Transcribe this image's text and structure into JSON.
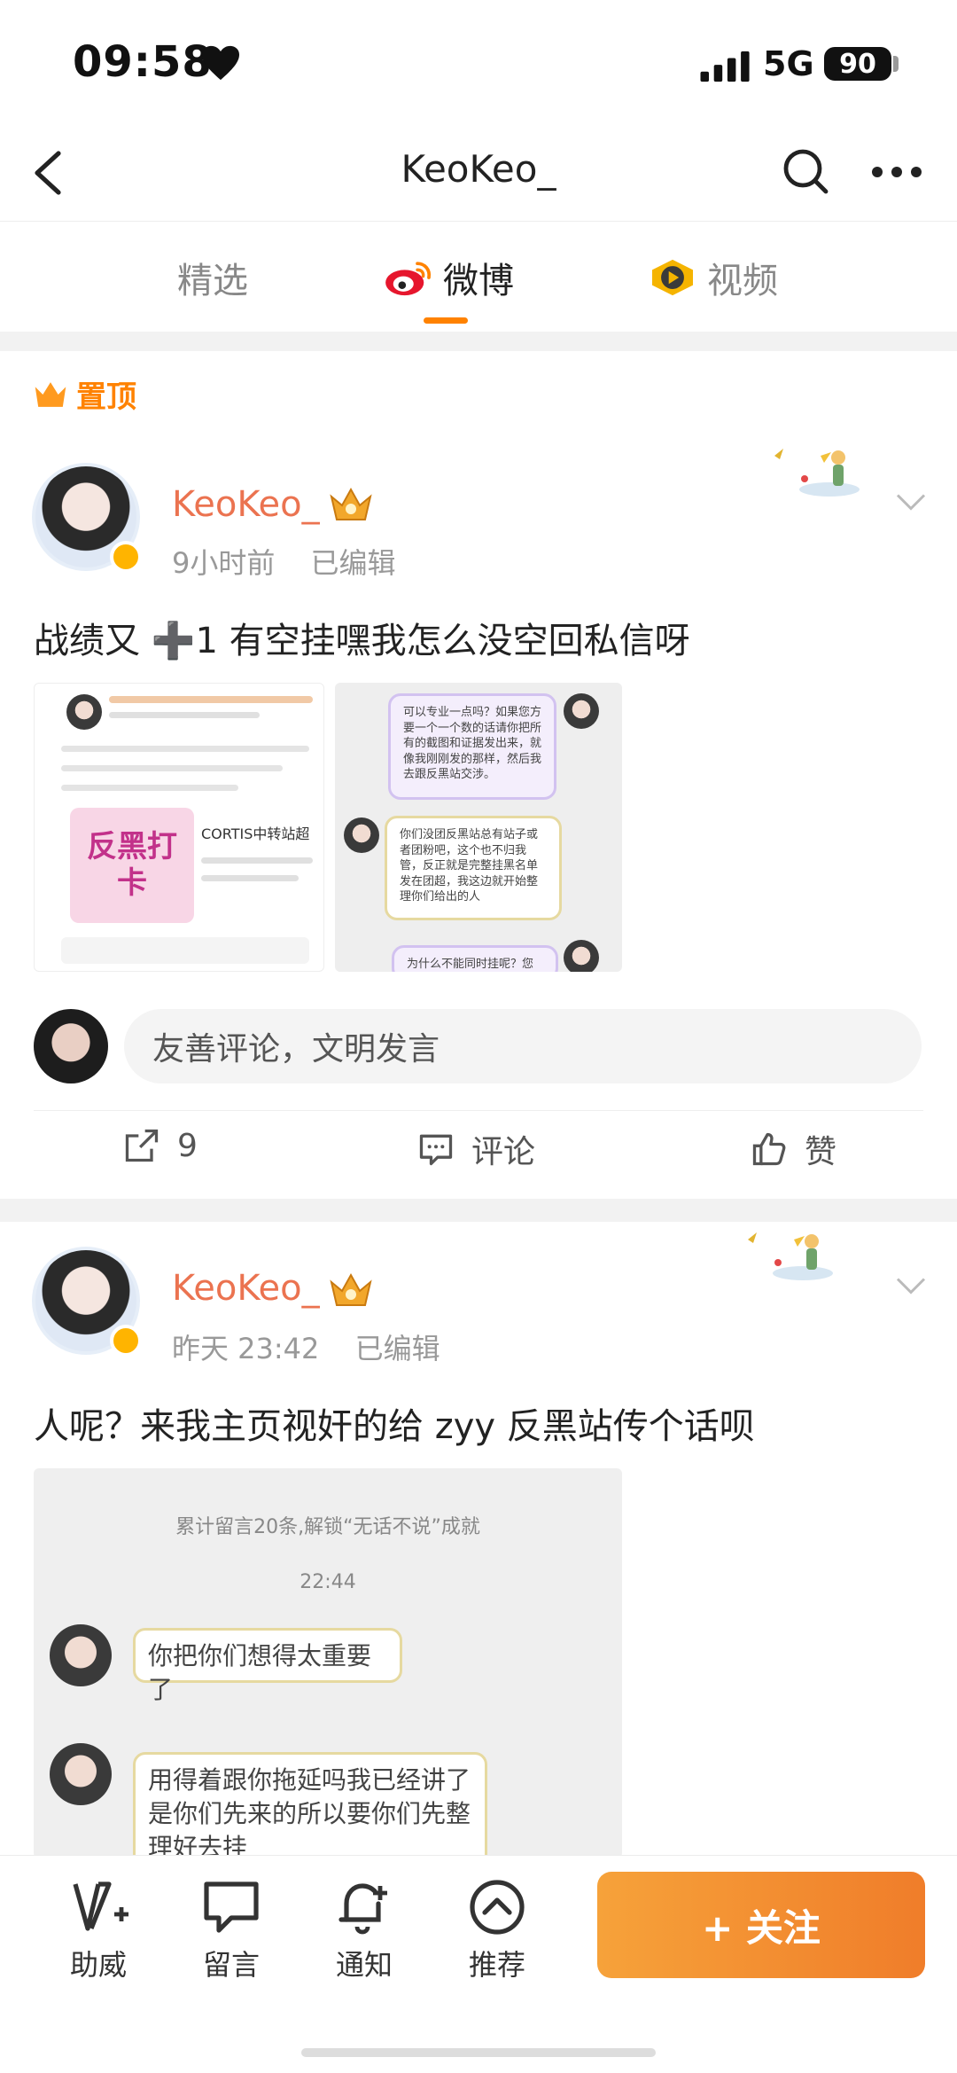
{
  "status": {
    "time": "09:58",
    "network": "5G",
    "battery": "90"
  },
  "nav": {
    "title": "KeoKeo_"
  },
  "tabs": [
    {
      "label": "精选",
      "active": false
    },
    {
      "label": "微博",
      "active": true
    },
    {
      "label": "视频",
      "active": false
    }
  ],
  "pinned_label": "置顶",
  "posts": [
    {
      "user": "KeoKeo_",
      "time": "9小时前",
      "edited": "已编辑",
      "text": "战绩又 ➕1 有空挂嘿我怎么没空回私信呀"
    },
    {
      "user": "KeoKeo_",
      "time": "昨天 23:42",
      "edited": "已编辑",
      "text": "人呢？来我主页视奸的给 zyy 反黑站传个话呗"
    }
  ],
  "comment_placeholder": "友善评论，文明发言",
  "actions": {
    "repost_count": "9",
    "comment": "评论",
    "like": "赞"
  },
  "thumb2": {
    "counter": "累计留言20条,解锁“无话不说”成就",
    "time": "22:44",
    "msg1": "你把你们想得太重要了",
    "msg2": "用得着跟你拖延吗我已经讲了是你们先来的所以要你们先整理好去挂"
  },
  "thumb1b": {
    "msg1": "可以专业一点吗？如果您方要一个一个数的话请你把所有的截图和证据发出来，就像我刚刚发的那样，然后我去跟反黑站交涉。",
    "msg2": "你们没团反黑站总有站子或者团粉吧，这个也不归我管，反正就是完整挂黑名单发在团超，我这边就开始整理你们给出的人",
    "msg3": "为什么不能同时挂呢？您方"
  },
  "thumb1a": {
    "title": "反黑打卡",
    "line": "CORTIS中转站超"
  },
  "bottom": {
    "items": [
      "助威",
      "留言",
      "通知",
      "推荐"
    ],
    "follow": "+ 关注"
  },
  "colors": {
    "accent": "#ff8200",
    "username": "#eb7350"
  }
}
